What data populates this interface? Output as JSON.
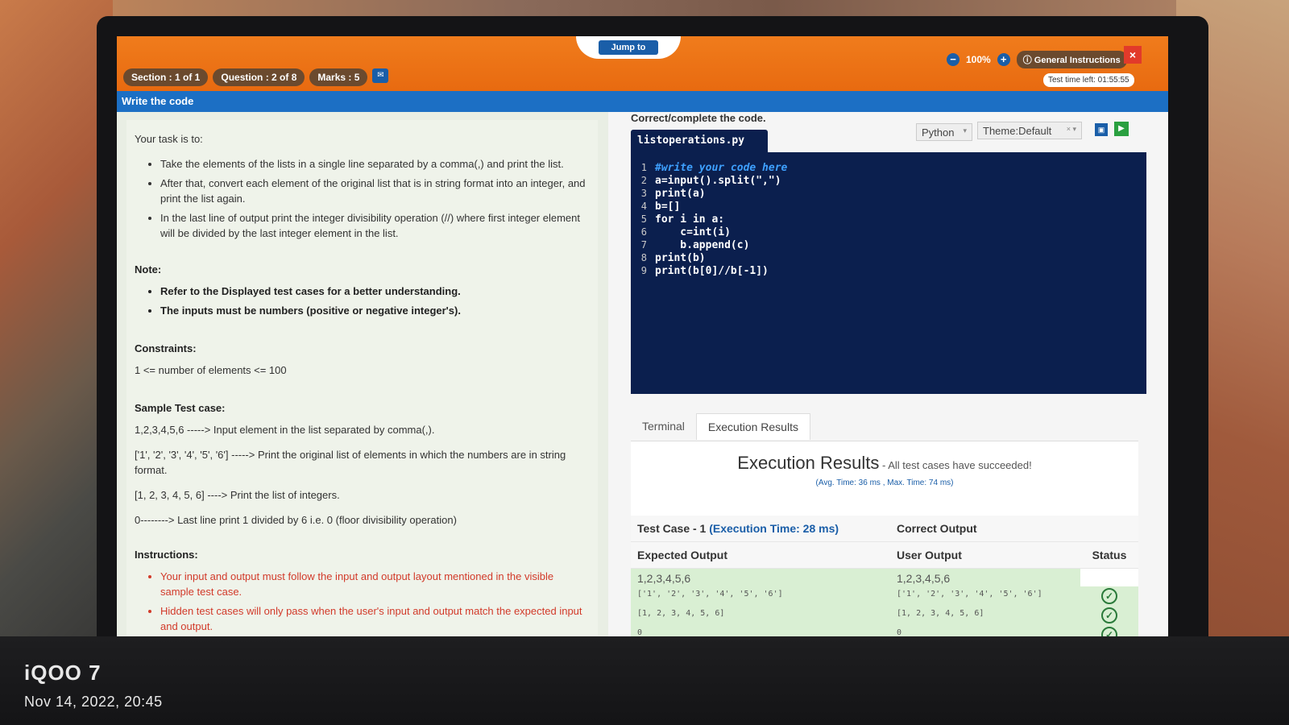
{
  "watermark": {
    "brand": "iQOO 7",
    "datetime": "Nov 14, 2022, 20:45"
  },
  "topbar": {
    "jump_label": "Jump to",
    "section": "Section : 1 of 1",
    "question": "Question : 2 of 8",
    "marks": "Marks : 5",
    "zoom_value": "100%",
    "general_instructions": "General Instructions",
    "time_left": "Test time left: 01:55:55",
    "close_label": "×"
  },
  "question_title": "Write the code",
  "task": {
    "intro": "Your task is to:",
    "bullets": [
      "Take the elements of the lists in a single line separated by a comma(,) and print the list.",
      "After that, convert each element of the original list that is in string format into an integer, and print the list again.",
      "In the last line of output print the integer divisibility operation (//) where first integer element will be divided by the last integer element in the list."
    ]
  },
  "note": {
    "heading": "Note:",
    "bullets": [
      "Refer to the Displayed test cases for a better understanding.",
      "The inputs must be numbers (positive or negative integer's)."
    ]
  },
  "constraints": {
    "heading": "Constraints:",
    "text": "1 <= number of elements <= 100"
  },
  "sample": {
    "heading": "Sample Test case:",
    "lines": [
      "1,2,3,4,5,6 -----> Input element in the list separated by comma(,).",
      "['1', '2', '3', '4', '5', '6'] -----> Print the original list of elements in which the numbers are in string format.",
      "[1, 2, 3, 4, 5, 6] ----> Print the list of integers.",
      "0--------> Last line print 1 divided by 6 i.e. 0 (floor divisibility operation)"
    ]
  },
  "instructions": {
    "heading": "Instructions:",
    "bullets": [
      "Your input and output must follow the input and output layout mentioned in the visible sample test case.",
      "Hidden test cases will only pass when the user's input and output match the expected input and output."
    ]
  },
  "editor": {
    "label": "Correct/complete the code.",
    "filename": "listoperations.py",
    "language": "Python",
    "theme": "Theme:Default",
    "lines": [
      "#write your code here",
      "a=input().split(\",\")",
      "print(a)",
      "b=[]",
      "for i in a:",
      "    c=int(i)",
      "    b.append(c)",
      "print(b)",
      "print(b[0]//b[-1])"
    ],
    "line_numbers": [
      "1",
      "2",
      "3",
      "4",
      "5",
      "6",
      "7",
      "8",
      "9"
    ]
  },
  "tabs": {
    "terminal": "Terminal",
    "execution": "Execution Results"
  },
  "results": {
    "title": "Execution Results",
    "subtitle": " - All test cases have succeeded!",
    "timing": "(Avg. Time: 36 ms , Max. Time: 74 ms)",
    "testcase_label": "Test Case - 1 ",
    "testcase_time": "(Execution Time: 28 ms)",
    "correct_output": "Correct Output",
    "expected_hdr": "Expected Output",
    "user_hdr": "User Output",
    "status_hdr": "Status",
    "expected_input": "1,2,3,4,5,6",
    "user_input": "1,2,3,4,5,6",
    "rows": [
      {
        "expected": "['1', '2', '3', '4', '5', '6']",
        "user": "['1', '2', '3', '4', '5', '6']"
      },
      {
        "expected": "[1, 2, 3, 4, 5, 6]",
        "user": "[1, 2, 3, 4, 5, 6]"
      },
      {
        "expected": "0",
        "user": "0"
      }
    ]
  },
  "colors": {
    "orange": "#e86a10",
    "blue": "#1c6fc4",
    "editor_bg": "#0b1f4e",
    "success_green": "#d9efd3"
  }
}
